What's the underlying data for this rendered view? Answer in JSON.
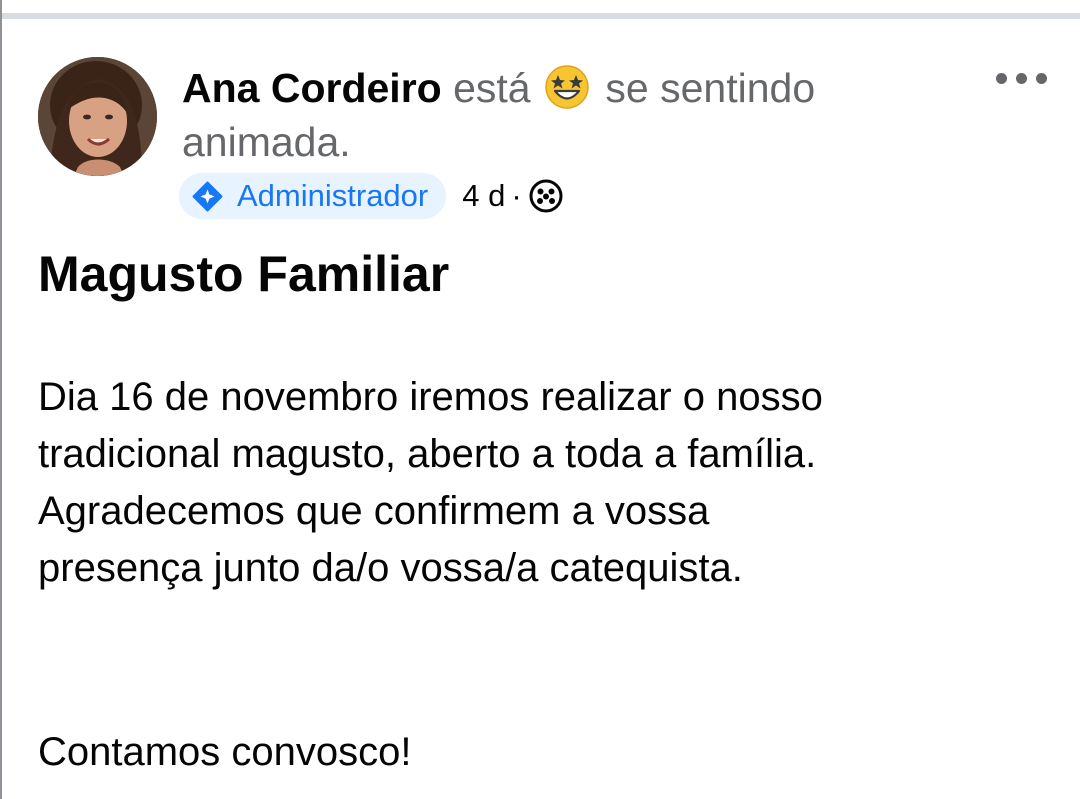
{
  "post": {
    "author": "Ana Cordeiro",
    "feeling_prefix": "está",
    "feeling_text": "se sentindo",
    "feeling_text_cont": "animada.",
    "feeling_emoji": "star-struck-emoji",
    "badge": {
      "icon": "admin-diamond-icon",
      "label": "Administrador"
    },
    "time": "4 d",
    "separator": "·",
    "audience_icon": "group-audience-icon",
    "title": "Magusto Familiar",
    "body_lines": [
      "Dia 16 de novembro iremos realizar o nosso",
      "tradicional magusto, aberto a toda a família.",
      "Agradecemos que confirmem a vossa",
      "presença junto da/o vossa/a catequista."
    ],
    "closing": "Contamos convosco!",
    "more_icon": "more-options-icon"
  },
  "colors": {
    "text_primary": "#050505",
    "text_secondary": "#65676b",
    "badge_bg": "#e7f3ff",
    "accent": "#1877f2",
    "divider": "#d9dce1"
  }
}
